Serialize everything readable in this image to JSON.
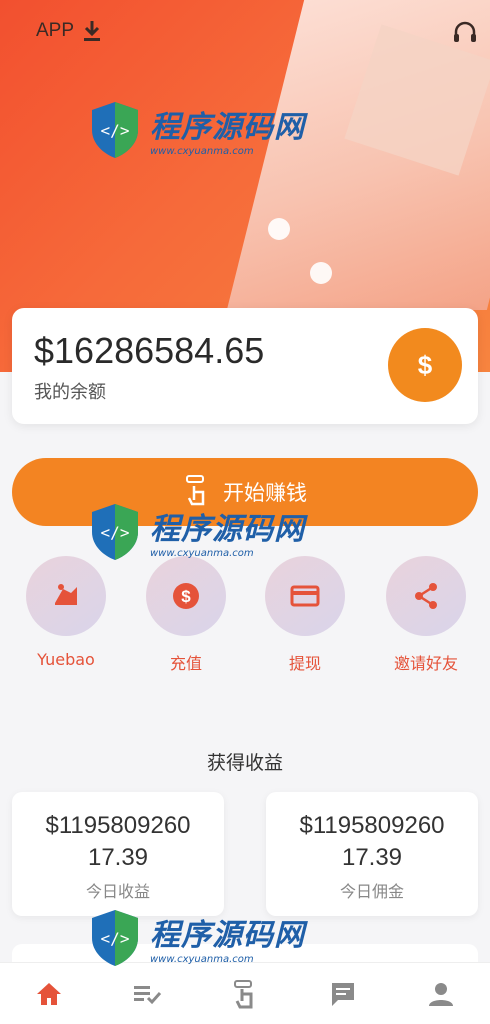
{
  "header": {
    "app_label": "APP"
  },
  "balance": {
    "amount": "$16286584.65",
    "label": "我的余额",
    "coin_symbol": "$"
  },
  "start_button": {
    "label": "开始赚钱"
  },
  "actions": [
    {
      "label": "Yuebao",
      "icon": "yuebao-icon"
    },
    {
      "label": "充值",
      "icon": "dollar-coin-icon"
    },
    {
      "label": "提现",
      "icon": "card-icon"
    },
    {
      "label": "邀请好友",
      "icon": "share-icon"
    }
  ],
  "earnings": {
    "title": "获得收益",
    "cards": [
      {
        "line1": "$1195809260",
        "line2": "17.39",
        "label": "今日收益"
      },
      {
        "line1": "$1195809260",
        "line2": "17.39",
        "label": "今日佣金"
      }
    ]
  },
  "tabs": [
    {
      "name": "home",
      "icon": "home-icon",
      "active": true
    },
    {
      "name": "tasks",
      "icon": "list-check-icon",
      "active": false
    },
    {
      "name": "earn",
      "icon": "tap-hand-icon",
      "active": false
    },
    {
      "name": "messages",
      "icon": "message-icon",
      "active": false
    },
    {
      "name": "profile",
      "icon": "person-icon",
      "active": false
    }
  ],
  "watermark": {
    "title": "程序源码网",
    "url": "www.cxyuanma.com"
  },
  "colors": {
    "primary": "#f38422",
    "hero": "#f2502f",
    "accent_text": "#e5533a"
  }
}
